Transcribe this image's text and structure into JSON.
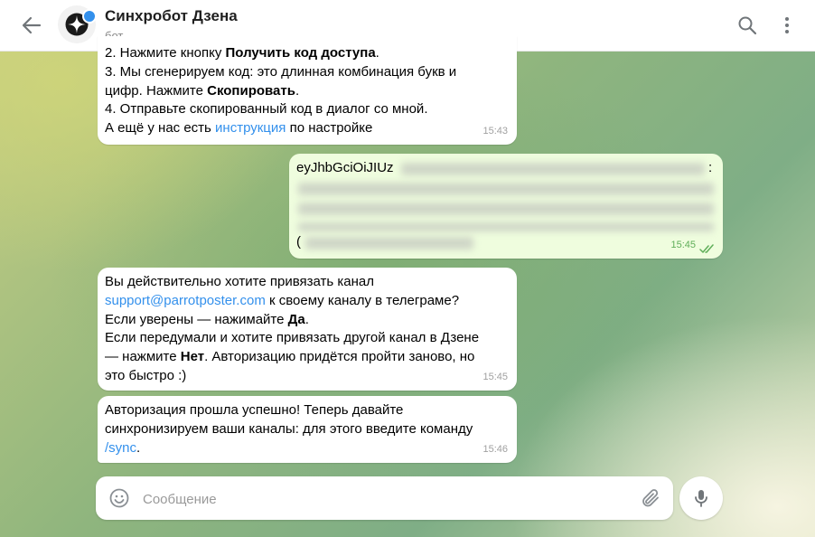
{
  "header": {
    "title": "Синхробот Дзена",
    "subtitle": "бот"
  },
  "messages": [
    {
      "id": "msg-1",
      "direction": "in",
      "lines": [
        [
          "2. Нажмите кнопку ",
          {
            "b": "Получить код доступа"
          },
          "."
        ],
        [
          "3. Мы сгенерируем код: это длинная комбинация букв и"
        ],
        [
          "цифр. Нажмите ",
          {
            "b": "Скопировать"
          },
          "."
        ],
        [
          "4. Отправьте скопированный код в диалог со мной."
        ],
        [
          "А ещё у нас есть ",
          {
            "a": "инструкция"
          },
          " по настройке"
        ]
      ],
      "time": "15:43"
    },
    {
      "id": "msg-2",
      "direction": "out",
      "visible_prefix": "eyJhbGciOiJIUz",
      "trailing_char": ":",
      "second_line_start": "(",
      "time": "15:45"
    },
    {
      "id": "msg-3",
      "direction": "in",
      "lines": [
        [
          "Вы действительно хотите привязать канал"
        ],
        [
          {
            "a": "support@parrotposter.com"
          },
          " к своему каналу в телеграме?"
        ],
        [
          "Если уверены — нажимайте ",
          {
            "b": "Да"
          },
          "."
        ],
        [
          "Если передумали и хотите привязать другой канал в Дзене"
        ],
        [
          "— нажмите ",
          {
            "b": "Нет"
          },
          ". Авторизацию придётся пройти заново, но"
        ],
        [
          "это быстро :)"
        ]
      ],
      "time": "15:45"
    },
    {
      "id": "msg-4",
      "direction": "in",
      "lines": [
        [
          "Авторизация прошла успешно! Теперь давайте"
        ],
        [
          "синхронизируем ваши каналы: для этого введите команду"
        ],
        [
          {
            "a": "/sync"
          },
          "."
        ]
      ],
      "time": "15:46"
    }
  ],
  "composer": {
    "placeholder": "Сообщение"
  },
  "icons": {
    "back": "arrow-left-icon",
    "search": "search-icon",
    "menu": "more-vertical-icon",
    "emoji": "smile-icon",
    "attach": "paperclip-icon",
    "mic": "microphone-icon",
    "read": "double-check-icon"
  },
  "colors": {
    "accent": "#3390ec",
    "outgoing_bubble": "#effdde",
    "read_check": "#5fae59"
  }
}
